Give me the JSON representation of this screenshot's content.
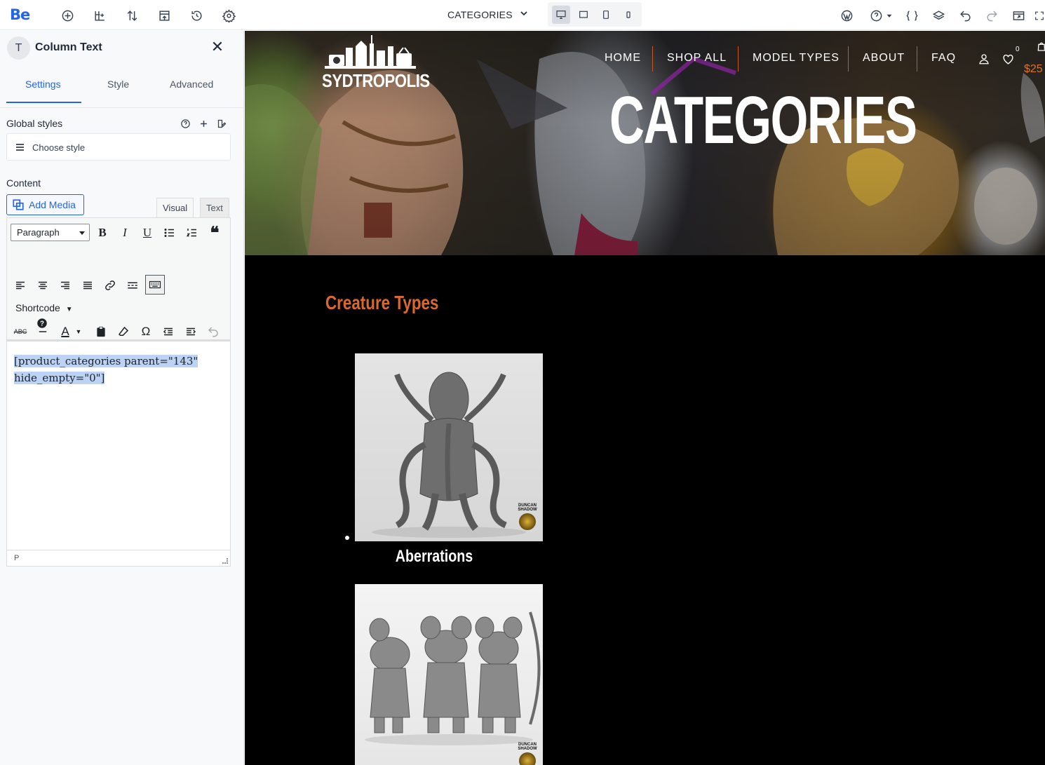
{
  "app": {
    "logo_text": "Be",
    "page_selector": "CATEGORIES",
    "toolbar_icons_left": [
      "add-element-icon",
      "add-section-icon",
      "sort-icon",
      "template-icon",
      "history-icon",
      "settings-icon"
    ],
    "toolbar_icons_right": [
      "wordpress-icon",
      "help-icon",
      "css-icon",
      "layers-icon",
      "undo-icon",
      "redo-icon",
      "preview-icon",
      "fullscreen-icon"
    ],
    "devices": [
      "desktop-icon",
      "laptop-icon",
      "tablet-icon",
      "mobile-icon"
    ],
    "active_device": "desktop",
    "accent_color": "#2563eb"
  },
  "panel": {
    "type_letter": "T",
    "title": "Column Text",
    "tabs": [
      "Settings",
      "Style",
      "Advanced"
    ],
    "active_tab": "Settings",
    "global_styles_label": "Global styles",
    "choose_style_placeholder": "Choose style",
    "content_label": "Content",
    "add_media_label": "Add Media",
    "editor_tabs": [
      "Visual",
      "Text"
    ],
    "format_select": "Paragraph",
    "shortcode_label": "Shortcode",
    "editor_content_line1": "[product_categories parent=\"143\"",
    "editor_content_line2": "hide_empty=\"0\"]",
    "status_path": "P"
  },
  "site": {
    "brand": "SYDTROPOLIS",
    "nav": [
      "HOME",
      "SHOP ALL",
      "MODEL TYPES",
      "ABOUT",
      "FAQ"
    ],
    "wishlist_count": "0",
    "cart_price": "$25",
    "hero_title": "CATEGORIES",
    "section_title": "Creature Types",
    "products": [
      {
        "label": "Aberrations",
        "watermark": "DUNCAN SHADOW"
      },
      {
        "label": "",
        "watermark": "DUNCAN SHADOW"
      }
    ],
    "accent_color": "#d9692f"
  }
}
